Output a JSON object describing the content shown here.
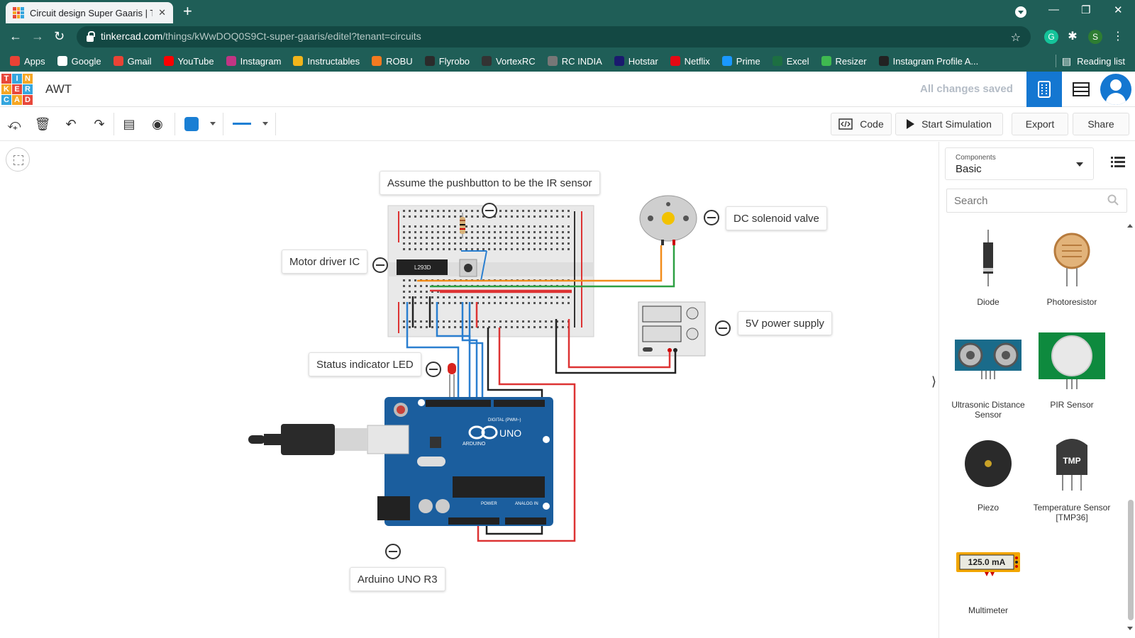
{
  "browser": {
    "tab_title": "Circuit design Super Gaaris | Tinkercad",
    "url_host": "tinkercad.com",
    "url_path": "/things/kWwDOQ0S9Ct-super-gaaris/editel?tenant=circuits",
    "bookmarks": [
      {
        "label": "Apps",
        "color": "#e94235"
      },
      {
        "label": "Google",
        "color": "#ffffff"
      },
      {
        "label": "Gmail",
        "color": "#ea4335"
      },
      {
        "label": "YouTube",
        "color": "#ff0000"
      },
      {
        "label": "Instagram",
        "color": "#c13584"
      },
      {
        "label": "Instructables",
        "color": "#f3b51b"
      },
      {
        "label": "ROBU",
        "color": "#f47a20"
      },
      {
        "label": "Flyrobo",
        "color": "#2b2b2b"
      },
      {
        "label": "VortexRC",
        "color": "#333333"
      },
      {
        "label": "RC INDIA",
        "color": "#777777"
      },
      {
        "label": "Hotstar",
        "color": "#1a1a6e"
      },
      {
        "label": "Netflix",
        "color": "#e50914"
      },
      {
        "label": "Prime",
        "color": "#1a98ff"
      },
      {
        "label": "Excel",
        "color": "#1d6f42"
      },
      {
        "label": "Resizer",
        "color": "#3fb950"
      },
      {
        "label": "Instagram Profile A...",
        "color": "#222222"
      }
    ],
    "reading_list": "Reading list",
    "profile_initial": "S"
  },
  "app": {
    "logo_letters": [
      "T",
      "I",
      "N",
      "K",
      "E",
      "R",
      "C",
      "A",
      "D"
    ],
    "project_title": "AWT",
    "save_status": "All changes saved"
  },
  "toolbar": {
    "code_label": "Code",
    "simulate_label": "Start Simulation",
    "export_label": "Export",
    "share_label": "Share",
    "fill_color": "#1a7fd4"
  },
  "canvas": {
    "labels": {
      "ir_note": "Assume the pushbutton to be the IR sensor",
      "motor_driver": "Motor driver IC",
      "solenoid": "DC solenoid valve",
      "power_supply": "5V power supply",
      "status_led": "Status indicator LED",
      "arduino": "Arduino UNO R3"
    },
    "chip_label": "L293D",
    "arduino_text": {
      "uno": "UNO",
      "brand": "ARDUINO",
      "digital": "DIGITAL (PWM~)",
      "power": "POWER",
      "analog": "ANALOG IN"
    }
  },
  "panel": {
    "components_label": "Components",
    "components_value": "Basic",
    "search_placeholder": "Search",
    "items": [
      {
        "name": "Diode"
      },
      {
        "name": "Photoresistor"
      },
      {
        "name": "Ultrasonic Distance Sensor"
      },
      {
        "name": "PIR Sensor"
      },
      {
        "name": "Piezo"
      },
      {
        "name": "Temperature Sensor [TMP36]"
      },
      {
        "name": "Multimeter"
      }
    ],
    "tmp_text": "TMP",
    "multimeter_reading": "125.0 mA"
  }
}
